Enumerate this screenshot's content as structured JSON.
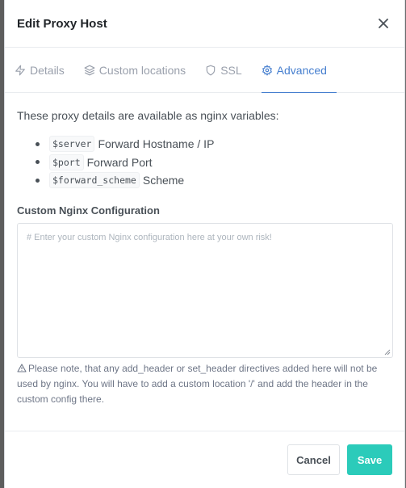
{
  "modal": {
    "title": "Edit Proxy Host"
  },
  "tabs": [
    {
      "label": "Details",
      "icon": "zap-icon",
      "active": false
    },
    {
      "label": "Custom locations",
      "icon": "layers-icon",
      "active": false
    },
    {
      "label": "SSL",
      "icon": "shield-icon",
      "active": false
    },
    {
      "label": "Advanced",
      "icon": "settings-icon",
      "active": true
    }
  ],
  "content": {
    "intro": "These proxy details are available as nginx variables:",
    "variables": [
      {
        "code": "$server",
        "desc": "Forward Hostname / IP"
      },
      {
        "code": "$port",
        "desc": "Forward Port"
      },
      {
        "code": "$forward_scheme",
        "desc": "Scheme"
      }
    ],
    "config_label": "Custom Nginx Configuration",
    "config_placeholder": "# Enter your custom Nginx configuration here at your own risk!",
    "note": "Please note, that any add_header or set_header directives added here will not be used by nginx. You will have to add a custom location '/' and add the header in the custom config there."
  },
  "footer": {
    "cancel_label": "Cancel",
    "save_label": "Save"
  },
  "colors": {
    "accent": "#467fcf",
    "save": "#2bcbba",
    "muted": "#9aa0ac"
  }
}
